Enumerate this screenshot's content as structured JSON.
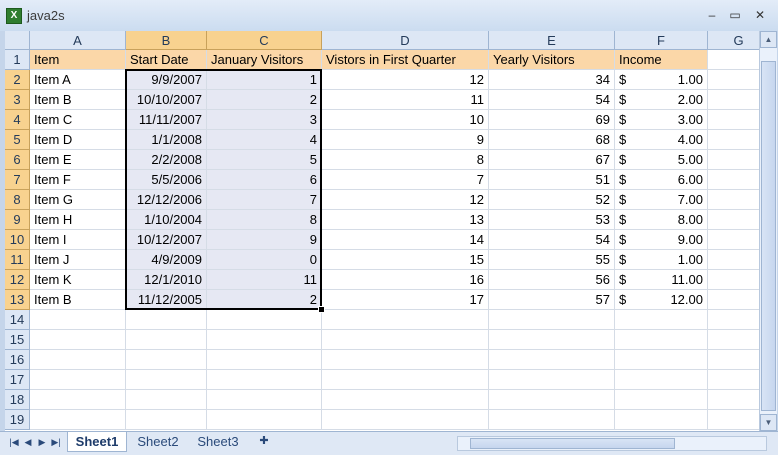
{
  "window": {
    "title": "java2s",
    "app_icon": "excel-icon"
  },
  "controls": {
    "minimize": "–",
    "restore": "▭",
    "close": "✕"
  },
  "columns": [
    "A",
    "B",
    "C",
    "D",
    "E",
    "F",
    "G"
  ],
  "row_numbers": [
    "1",
    "2",
    "3",
    "4",
    "5",
    "6",
    "7",
    "8",
    "9",
    "10",
    "11",
    "12",
    "13",
    "14",
    "15",
    "16",
    "17",
    "18",
    "19"
  ],
  "headers": [
    "Item",
    "Start Date",
    "January Visitors",
    "Vistors in First Quarter",
    "Yearly Visitors",
    "Income"
  ],
  "rows": [
    {
      "item": "Item A",
      "start": "9/9/2007",
      "jan": "1",
      "q1": "12",
      "yearly": "34",
      "cur": "$",
      "income": "1.00"
    },
    {
      "item": "Item B",
      "start": "10/10/2007",
      "jan": "2",
      "q1": "11",
      "yearly": "54",
      "cur": "$",
      "income": "2.00"
    },
    {
      "item": "Item C",
      "start": "11/11/2007",
      "jan": "3",
      "q1": "10",
      "yearly": "69",
      "cur": "$",
      "income": "3.00"
    },
    {
      "item": "Item D",
      "start": "1/1/2008",
      "jan": "4",
      "q1": "9",
      "yearly": "68",
      "cur": "$",
      "income": "4.00"
    },
    {
      "item": "Item E",
      "start": "2/2/2008",
      "jan": "5",
      "q1": "8",
      "yearly": "67",
      "cur": "$",
      "income": "5.00"
    },
    {
      "item": "Item F",
      "start": "5/5/2006",
      "jan": "6",
      "q1": "7",
      "yearly": "51",
      "cur": "$",
      "income": "6.00"
    },
    {
      "item": "Item G",
      "start": "12/12/2006",
      "jan": "7",
      "q1": "12",
      "yearly": "52",
      "cur": "$",
      "income": "7.00"
    },
    {
      "item": "Item H",
      "start": "1/10/2004",
      "jan": "8",
      "q1": "13",
      "yearly": "53",
      "cur": "$",
      "income": "8.00"
    },
    {
      "item": "Item I",
      "start": "10/12/2007",
      "jan": "9",
      "q1": "14",
      "yearly": "54",
      "cur": "$",
      "income": "9.00"
    },
    {
      "item": "Item J",
      "start": "4/9/2009",
      "jan": "0",
      "q1": "15",
      "yearly": "55",
      "cur": "$",
      "income": "1.00"
    },
    {
      "item": "Item K",
      "start": "12/1/2010",
      "jan": "11",
      "q1": "16",
      "yearly": "56",
      "cur": "$",
      "income": "11.00"
    },
    {
      "item": "Item B",
      "start": "11/12/2005",
      "jan": "2",
      "q1": "17",
      "yearly": "57",
      "cur": "$",
      "income": "12.00"
    }
  ],
  "sheet_tabs": [
    {
      "label": "Sheet1",
      "active": true
    },
    {
      "label": "Sheet2",
      "active": false
    },
    {
      "label": "Sheet3",
      "active": false
    }
  ],
  "nav_icons": [
    "first-sheet-icon",
    "prev-sheet-icon",
    "next-sheet-icon",
    "last-sheet-icon"
  ],
  "colors": {
    "header_fill": "#fbd7a8",
    "selection_fill": "#e6e8f3",
    "selected_header": "#f8d28f"
  }
}
